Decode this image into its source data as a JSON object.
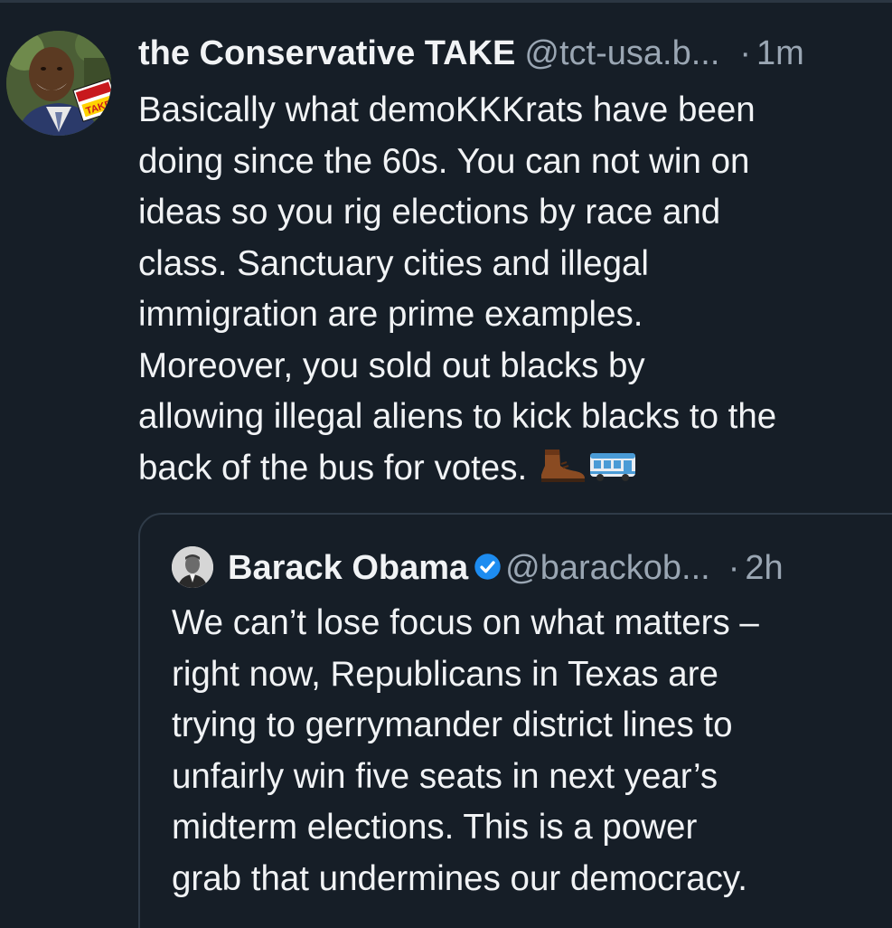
{
  "post": {
    "display_name": "the Conservative TAKE",
    "handle": "@tct-usa.b...",
    "separator": "·",
    "time": "1m",
    "avatar_badge_text": "TAKE",
    "text_lines": [
      "Basically what demoKKKrats have been",
      "doing since the 60s. You can not win on",
      "ideas so you rig elections by race and",
      "class. Sanctuary cities and illegal",
      "immigration are prime examples.",
      "Moreover,  you sold out blacks by",
      "allowing illegal aliens to kick blacks to the",
      "back of the bus for votes."
    ],
    "emojis": [
      "boot-emoji",
      "bus-emoji"
    ]
  },
  "quoted_post": {
    "display_name": "Barack Obama",
    "verified": true,
    "handle": "@barackob...",
    "separator": "·",
    "time": "2h",
    "text_lines": [
      "We can’t lose focus on what matters –",
      "right now, Republicans in Texas are",
      "trying to gerrymander district lines to",
      "unfairly win five seats in next year’s",
      "midterm elections. This is a power",
      "grab that undermines our democracy."
    ]
  },
  "colors": {
    "background": "#161e27",
    "text_primary": "#f1f3f5",
    "text_secondary": "#9aa6b3",
    "border": "#2f3b48",
    "verified_blue": "#1d8cf0"
  }
}
